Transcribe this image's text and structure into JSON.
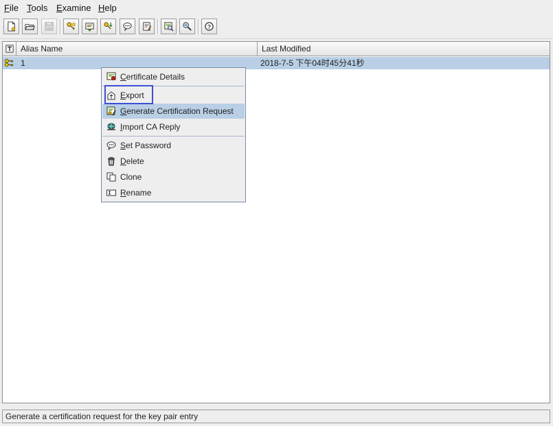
{
  "menubar": {
    "items": [
      {
        "name": "file",
        "label": "File",
        "mnemonic": "F",
        "rest": "ile"
      },
      {
        "name": "tools",
        "label": "Tools",
        "mnemonic": "T",
        "rest": "ools"
      },
      {
        "name": "examine",
        "label": "Examine",
        "mnemonic": "E",
        "rest": "xamine"
      },
      {
        "name": "help",
        "label": "Help",
        "mnemonic": "H",
        "rest": "elp"
      }
    ]
  },
  "toolbar": {
    "buttons": [
      {
        "icon": "new-keystore-icon"
      },
      {
        "icon": "open-keystore-icon"
      },
      {
        "icon": "save-keystore-icon",
        "disabled": true
      },
      {
        "icon": "generate-key-pair-icon"
      },
      {
        "icon": "import-trusted-certificate-icon"
      },
      {
        "icon": "import-key-pair-icon"
      },
      {
        "icon": "set-password-icon"
      },
      {
        "icon": "keystore-properties-icon"
      },
      {
        "icon": "examine-certificate-icon"
      },
      {
        "icon": "examine-ssl-icon"
      },
      {
        "icon": "help-icon"
      }
    ]
  },
  "table": {
    "columns": [
      "Alias Name",
      "Last Modified"
    ],
    "rows": [
      {
        "type_icon": "key-pair-icon",
        "alias": "1",
        "last_modified": "2018-7-5 下午04时45分41秒"
      }
    ]
  },
  "context_menu": {
    "items": [
      {
        "name": "certificate-details",
        "mnemonic": "C",
        "rest": "ertificate Details",
        "icon": "certificate-details-icon"
      },
      {
        "name": "export",
        "mnemonic": "E",
        "rest": "xport",
        "icon": "export-icon"
      },
      {
        "name": "generate-csr",
        "mnemonic": "G",
        "rest": "enerate Certification Request",
        "icon": "generate-csr-icon",
        "active": true
      },
      {
        "name": "import-ca-reply",
        "mnemonic": "I",
        "rest": "mport CA Reply",
        "icon": "import-ca-reply-icon"
      },
      {
        "name": "set-password",
        "mnemonic": "S",
        "rest": "et Password",
        "icon": "set-password-icon"
      },
      {
        "name": "delete",
        "mnemonic": "D",
        "rest": "elete",
        "icon": "delete-icon"
      },
      {
        "name": "clone",
        "mnemonic": "",
        "rest": "Clone",
        "icon": "clone-icon"
      },
      {
        "name": "rename",
        "mnemonic": "R",
        "rest": "ename",
        "icon": "rename-icon"
      }
    ]
  },
  "status": {
    "text": "Generate a certification request for the key pair entry"
  },
  "colors": {
    "selection": "#b8cfe5",
    "focus_border": "#3b4fd4",
    "background": "#eeeeee"
  }
}
